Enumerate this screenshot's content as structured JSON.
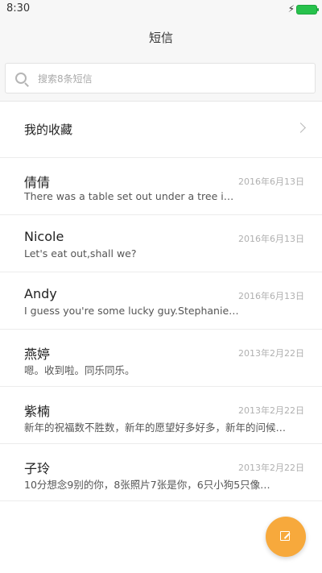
{
  "status_bar": {
    "time": "8:30"
  },
  "header": {
    "title": "短信"
  },
  "search": {
    "placeholder": "搜索8条短信"
  },
  "favorites": {
    "label": "我的收藏"
  },
  "messages": [
    {
      "name": "倩倩",
      "date": "2016年6月13日",
      "preview": "There was a table set out under a tree i…"
    },
    {
      "name": "Nicole",
      "date": "2016年6月13日",
      "preview": "Let's eat out,shall we?"
    },
    {
      "name": "Andy",
      "date": "2016年6月13日",
      "preview": "I guess you're some lucky guy.Stephanie…"
    },
    {
      "name": "燕婷",
      "date": "2013年2月22日",
      "preview": "嗯。收到啦。同乐同乐。"
    },
    {
      "name": "紫楠",
      "date": "2013年2月22日",
      "preview": "新年的祝福数不胜数，新年的愿望好多好多，新年的问候…"
    },
    {
      "name": "子玲",
      "date": "2013年2月22日",
      "preview": "10分想念9别的你，8张照片7张是你，6只小狗5只像…"
    }
  ],
  "colors": {
    "fab": "#f7a93c",
    "battery": "#27c24c"
  }
}
